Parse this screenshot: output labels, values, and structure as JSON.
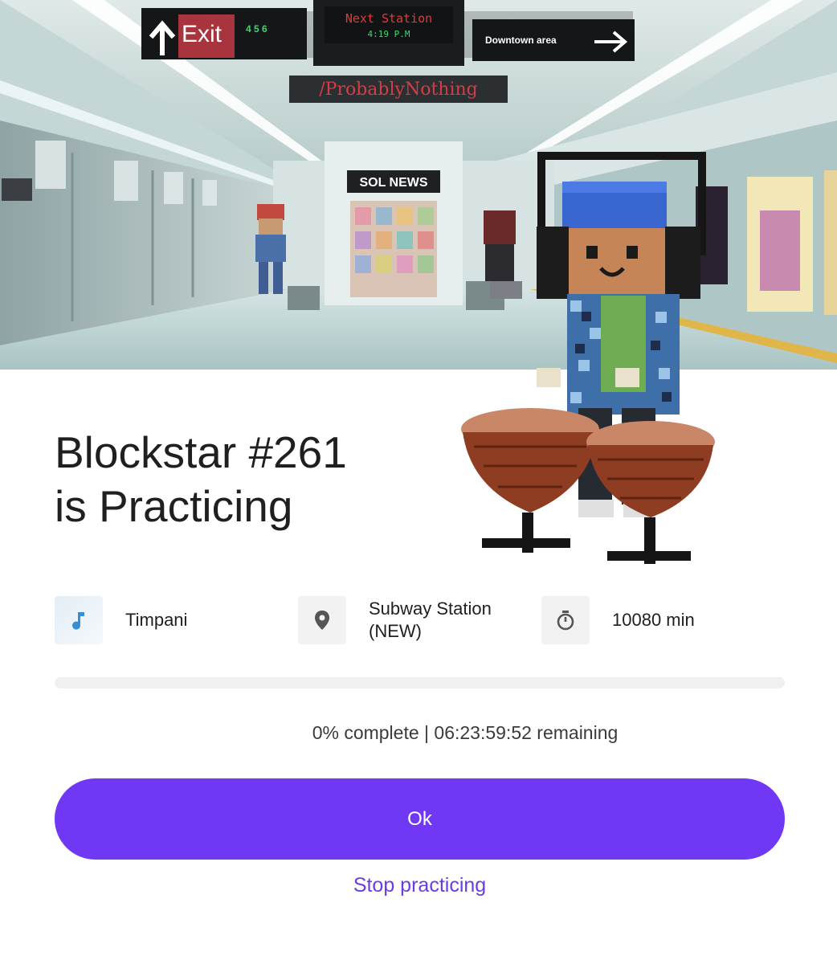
{
  "scene": {
    "signs": {
      "exit": "Exit",
      "lines": "4 5 6",
      "next_station": "Next Station",
      "time": "4:19 P.M",
      "direction": "Downtown area",
      "banner": "/ProbablyNothing",
      "kiosk": "SOL NEWS"
    }
  },
  "title": {
    "line1": "Blockstar #261",
    "line2": "is Practicing"
  },
  "info": {
    "instrument": {
      "icon": "music-note-icon",
      "label": "Timpani"
    },
    "location": {
      "icon": "location-pin-icon",
      "label": "Subway Station (NEW)"
    },
    "duration": {
      "icon": "stopwatch-icon",
      "label": "10080 min"
    }
  },
  "progress": {
    "percent": 0,
    "status_text": "0% complete | 06:23:59:52 remaining"
  },
  "actions": {
    "ok_label": "Ok",
    "stop_label": "Stop practicing"
  },
  "colors": {
    "accent": "#7038f5",
    "link": "#6a3ce6"
  }
}
